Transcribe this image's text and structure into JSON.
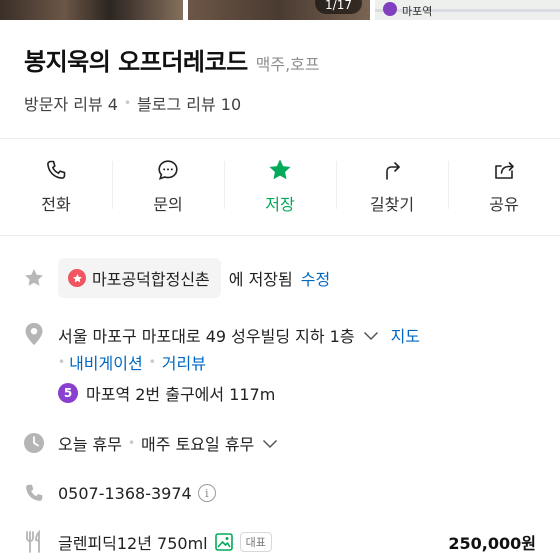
{
  "photos": {
    "counter": "1/17",
    "map_station_label": "마포역"
  },
  "place": {
    "name": "봉지욱의 오프더레코드",
    "category": "맥주,호프",
    "visitor_reviews": "방문자 리뷰 4",
    "blog_reviews": "블로그 리뷰 10"
  },
  "actions": [
    {
      "label": "전화",
      "icon": "phone-icon"
    },
    {
      "label": "문의",
      "icon": "chat-icon"
    },
    {
      "label": "저장",
      "icon": "star-icon"
    },
    {
      "label": "길찾기",
      "icon": "directions-icon"
    },
    {
      "label": "공유",
      "icon": "share-icon"
    }
  ],
  "saved": {
    "list_name": "마포공덕합정신촌",
    "suffix": "에 저장됨",
    "edit_label": "수정"
  },
  "address": {
    "text": "서울 마포구 마포대로 49 성우빌딩 지하 1층",
    "map_label": "지도",
    "navigation_label": "내비게이션",
    "street_view_label": "거리뷰",
    "subway_line": "5",
    "subway_directions": "마포역 2번 출구에서 117m"
  },
  "hours": {
    "today": "오늘 휴무",
    "schedule": "매주 토요일 휴무"
  },
  "phone": {
    "number": "0507-1368-3974",
    "info_glyph": "i"
  },
  "menu": {
    "item_name": "글렌피딕12년 750ml",
    "badge": "대표",
    "price": "250,000원"
  },
  "colors": {
    "accent_green": "#03aa5a",
    "link_blue": "#0068c3",
    "subway_line_5": "#8b3fcf",
    "save_chip_star": "#f05662"
  }
}
